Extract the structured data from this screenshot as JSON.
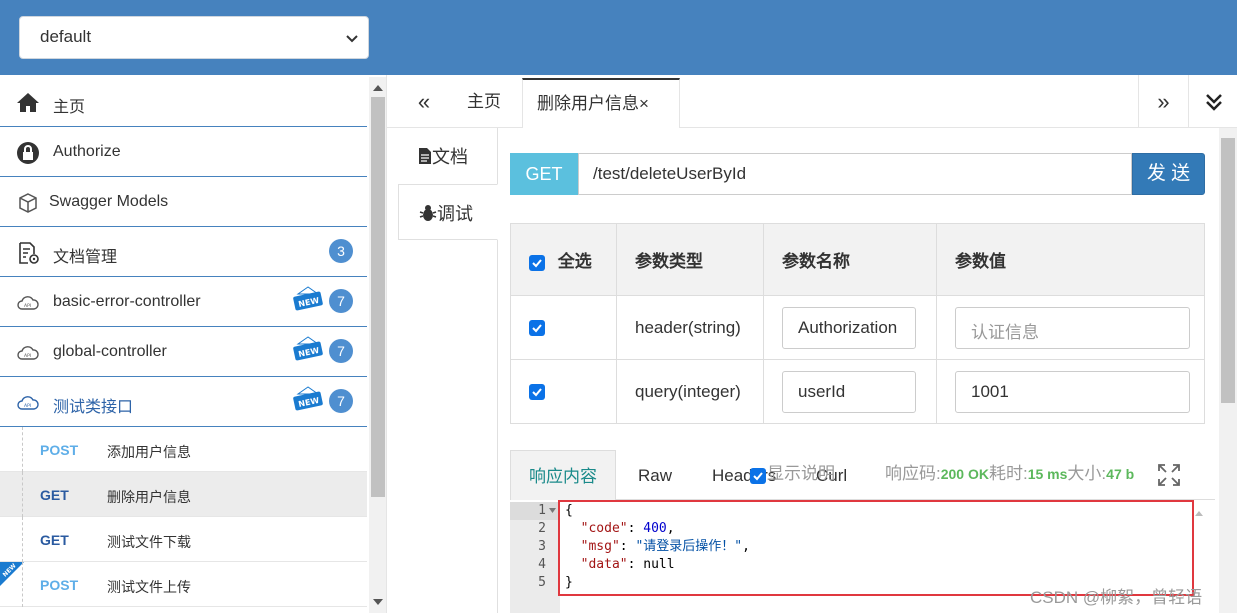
{
  "header": {
    "group_select": "default"
  },
  "sidebar": {
    "items": [
      {
        "label": "主页",
        "icon": "home-icon"
      },
      {
        "label": "Authorize",
        "icon": "lock-icon"
      },
      {
        "label": "Swagger Models",
        "icon": "cube-icon"
      },
      {
        "label": "文档管理",
        "icon": "doc-settings-icon",
        "badge": "3"
      },
      {
        "label": "basic-error-controller",
        "icon": "api-cloud-icon",
        "badge": "7",
        "new_tag": "NEW"
      },
      {
        "label": "global-controller",
        "icon": "api-cloud-icon",
        "badge": "7",
        "new_tag": "NEW"
      },
      {
        "label": "测试类接口",
        "icon": "api-cloud-icon",
        "badge": "7",
        "new_tag": "NEW"
      }
    ],
    "endpoints": [
      {
        "method": "POST",
        "name": "添加用户信息"
      },
      {
        "method": "GET",
        "name": "删除用户信息"
      },
      {
        "method": "GET",
        "name": "测试文件下载"
      },
      {
        "method": "POST",
        "name": "测试文件上传"
      }
    ],
    "corner_new": "NEW"
  },
  "tabs": {
    "prev": "«",
    "home": "主页",
    "active": "删除用户信息",
    "close": "×",
    "next": "»",
    "more": "expand-down-icon"
  },
  "vtabs": {
    "doc": "文档",
    "debug": "调试"
  },
  "request": {
    "method": "GET",
    "url": "/test/deleteUserById",
    "send": "发 送"
  },
  "params": {
    "headers": [
      "全选",
      "参数类型",
      "参数名称",
      "参数值"
    ],
    "rows": [
      {
        "type": "header(string)",
        "name": "Authorization",
        "value": "",
        "placeholder": "认证信息"
      },
      {
        "type": "query(integer)",
        "name": "userId",
        "value": "1001",
        "placeholder": ""
      }
    ]
  },
  "response": {
    "tabs": [
      "响应内容",
      "Raw",
      "Headers",
      "Curl"
    ],
    "show_desc": "显示说明",
    "code_label": "响应码:",
    "code_value": "200 OK",
    "time_label": "耗时:",
    "time_value": "15 ms",
    "size_label": "大小:",
    "size_value": "47 b",
    "line_numbers": [
      "1",
      "2",
      "3",
      "4",
      "5"
    ],
    "json_open": "{",
    "json_close": "}",
    "code_key": "\"code\"",
    "code_val": "400",
    "msg_key": "\"msg\"",
    "msg_val": "\"请登录后操作！\"",
    "data_key": "\"data\"",
    "data_val": "null"
  },
  "watermark": "CSDN @柳絮，曾轻语",
  "colors": {
    "header_bg": "#4682be",
    "get": "#5bc0de",
    "send": "#337ab7",
    "highlight": "#e0383f"
  }
}
